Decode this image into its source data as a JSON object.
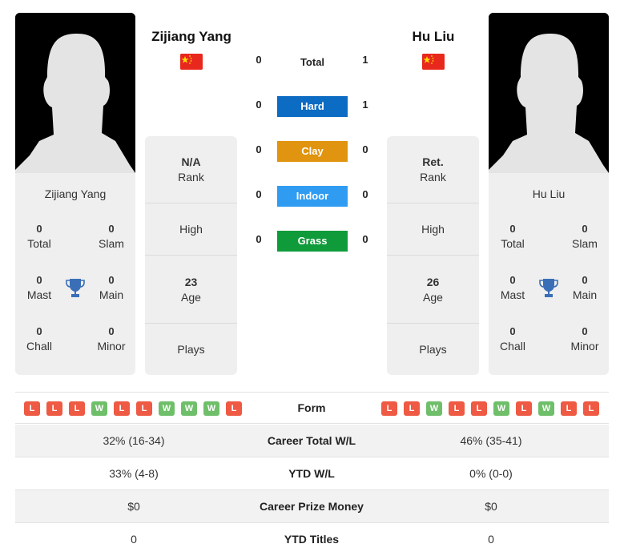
{
  "players": [
    {
      "name": "Zijiang Yang",
      "country_flag": "china-flag",
      "rank": "N/A",
      "rank_label": "Rank",
      "high_label": "High",
      "age": "23",
      "age_label": "Age",
      "plays_label": "Plays",
      "titles": {
        "total": "0",
        "total_label": "Total",
        "slam": "0",
        "slam_label": "Slam",
        "mast": "0",
        "mast_label": "Mast",
        "main": "0",
        "main_label": "Main",
        "chall": "0",
        "chall_label": "Chall",
        "minor": "0",
        "minor_label": "Minor"
      },
      "form": [
        "L",
        "L",
        "L",
        "W",
        "L",
        "L",
        "W",
        "W",
        "W",
        "L"
      ]
    },
    {
      "name": "Hu Liu",
      "country_flag": "china-flag",
      "rank": "Ret.",
      "rank_label": "Rank",
      "high_label": "High",
      "age": "26",
      "age_label": "Age",
      "plays_label": "Plays",
      "titles": {
        "total": "0",
        "total_label": "Total",
        "slam": "0",
        "slam_label": "Slam",
        "mast": "0",
        "mast_label": "Mast",
        "main": "0",
        "main_label": "Main",
        "chall": "0",
        "chall_label": "Chall",
        "minor": "0",
        "minor_label": "Minor"
      },
      "form": [
        "L",
        "L",
        "W",
        "L",
        "L",
        "W",
        "L",
        "W",
        "L",
        "L"
      ]
    }
  ],
  "h2h": {
    "total": {
      "label": "Total",
      "left": "0",
      "right": "1"
    },
    "surfaces": [
      {
        "label": "Hard",
        "left": "0",
        "right": "1",
        "color": "#0c6bc2"
      },
      {
        "label": "Clay",
        "left": "0",
        "right": "0",
        "color": "#e0940f"
      },
      {
        "label": "Indoor",
        "left": "0",
        "right": "0",
        "color": "#2f9cf2"
      },
      {
        "label": "Grass",
        "left": "0",
        "right": "0",
        "color": "#109b3b"
      }
    ]
  },
  "form_label": "Form",
  "stats_rows": [
    {
      "label": "Career Total W/L",
      "left": "32% (16-34)",
      "right": "46% (35-41)"
    },
    {
      "label": "YTD W/L",
      "left": "33% (4-8)",
      "right": "0% (0-0)"
    },
    {
      "label": "Career Prize Money",
      "left": "$0",
      "right": "$0"
    },
    {
      "label": "YTD Titles",
      "left": "0",
      "right": "0"
    }
  ]
}
